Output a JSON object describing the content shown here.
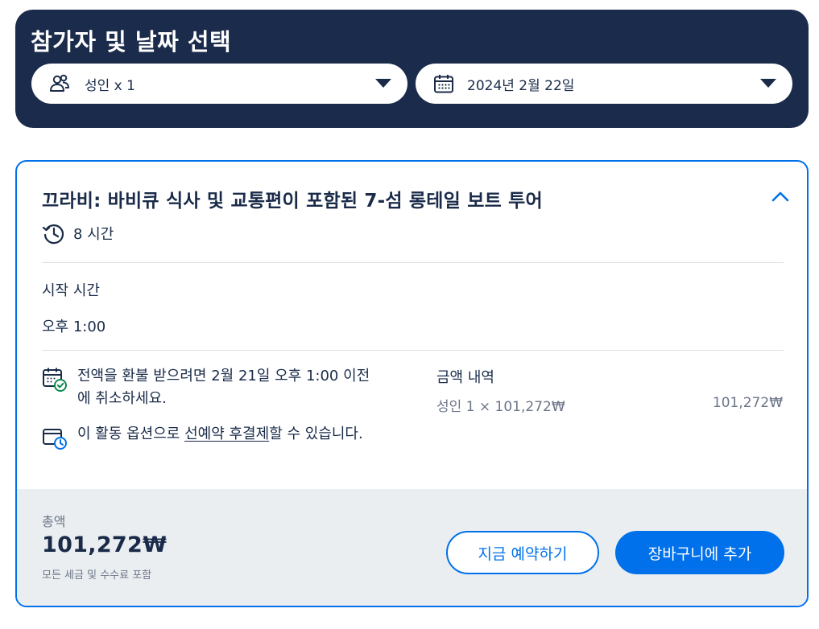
{
  "header": {
    "title": "참가자 및 날짜 선택",
    "participants": {
      "icon": "group-icon",
      "value": "성인 x 1"
    },
    "date": {
      "icon": "calendar-icon",
      "value": "2024년 2월 22일"
    }
  },
  "option": {
    "title": "끄라비: 바비큐 식사 및 교통편이 포함된 7-섬 롱테일 보트 투어",
    "duration": "8 시간",
    "start_time_label": "시작 시간",
    "start_time_value": "오후 1:00",
    "refund_text": "전액을 환불 받으려면 2월 21일 오후 1:00 이전에 취소하세요.",
    "reserve_prefix": "이 활동 옵션으로 ",
    "reserve_link": "선예약 후결제",
    "reserve_suffix": "할 수 있습니다.",
    "price_breakdown_label": "금액 내역",
    "price_line_label": "성인 1 × 101,272₩",
    "price_line_amount": "101,272₩"
  },
  "footer": {
    "total_label": "총액",
    "total_value": "101,272₩",
    "total_note": "모든 세금 및 수수료 포함",
    "book_now_label": "지금 예약하기",
    "add_to_cart_label": "장바구니에 추가"
  },
  "colors": {
    "header_bg": "#1b2b4b",
    "accent": "#0071eb",
    "text": "#1a2b49",
    "muted": "#6b7589",
    "footer_bg": "#ebeef1",
    "success": "#0b8a4e"
  }
}
